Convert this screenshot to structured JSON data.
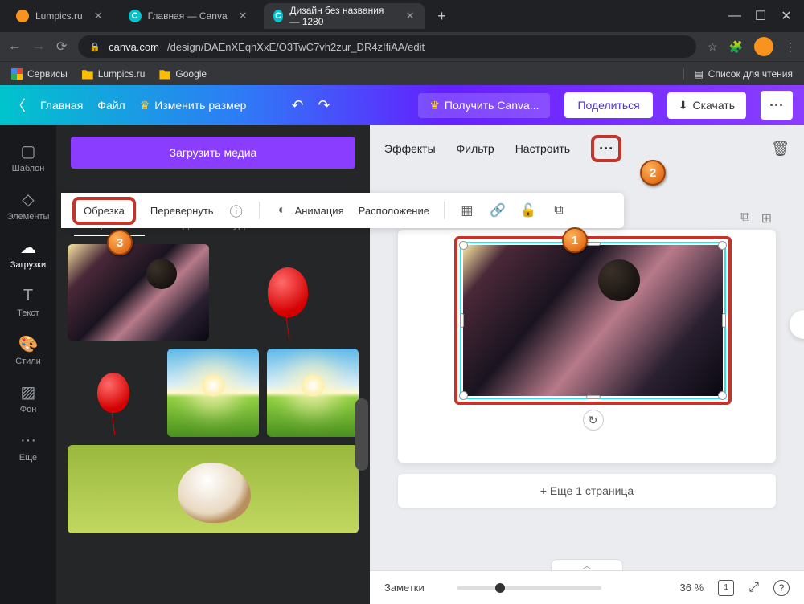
{
  "browser": {
    "tabs": [
      {
        "title": "Lumpics.ru"
      },
      {
        "title": "Главная — Canva"
      },
      {
        "title": "Дизайн без названия — 1280"
      }
    ],
    "url_host": "canva.com",
    "url_path": "/design/DAEnXEqhXxE/O3TwC7vh2zur_DR4zIfiAA/edit",
    "bookmarks": {
      "services": "Сервисы",
      "lumpics": "Lumpics.ru",
      "google": "Google"
    },
    "reading_list": "Список для чтения"
  },
  "header": {
    "home": "Главная",
    "file": "Файл",
    "resize": "Изменить размер",
    "get_canva": "Получить Canva...",
    "share": "Поделиться",
    "download": "Скачать"
  },
  "rail": {
    "templates": "Шаблон",
    "elements": "Элементы",
    "uploads": "Загрузки",
    "text": "Текст",
    "styles": "Стили",
    "background": "Фон",
    "more": "Еще"
  },
  "panel": {
    "upload": "Загрузить медиа",
    "tabs": {
      "images": "Изображения",
      "video": "Видео",
      "audio": "Аудио"
    }
  },
  "image_toolbar": {
    "effects": "Эффекты",
    "filter": "Фильтр",
    "adjust": "Настроить"
  },
  "sub_toolbar": {
    "crop": "Обрезка",
    "flip": "Перевернуть",
    "animation": "Анимация",
    "position": "Расположение"
  },
  "canvas": {
    "add_page": "+ Еще 1 страница"
  },
  "footer": {
    "notes": "Заметки",
    "zoom": "36 %",
    "page": "1"
  },
  "markers": {
    "m1": "1",
    "m2": "2",
    "m3": "3"
  }
}
